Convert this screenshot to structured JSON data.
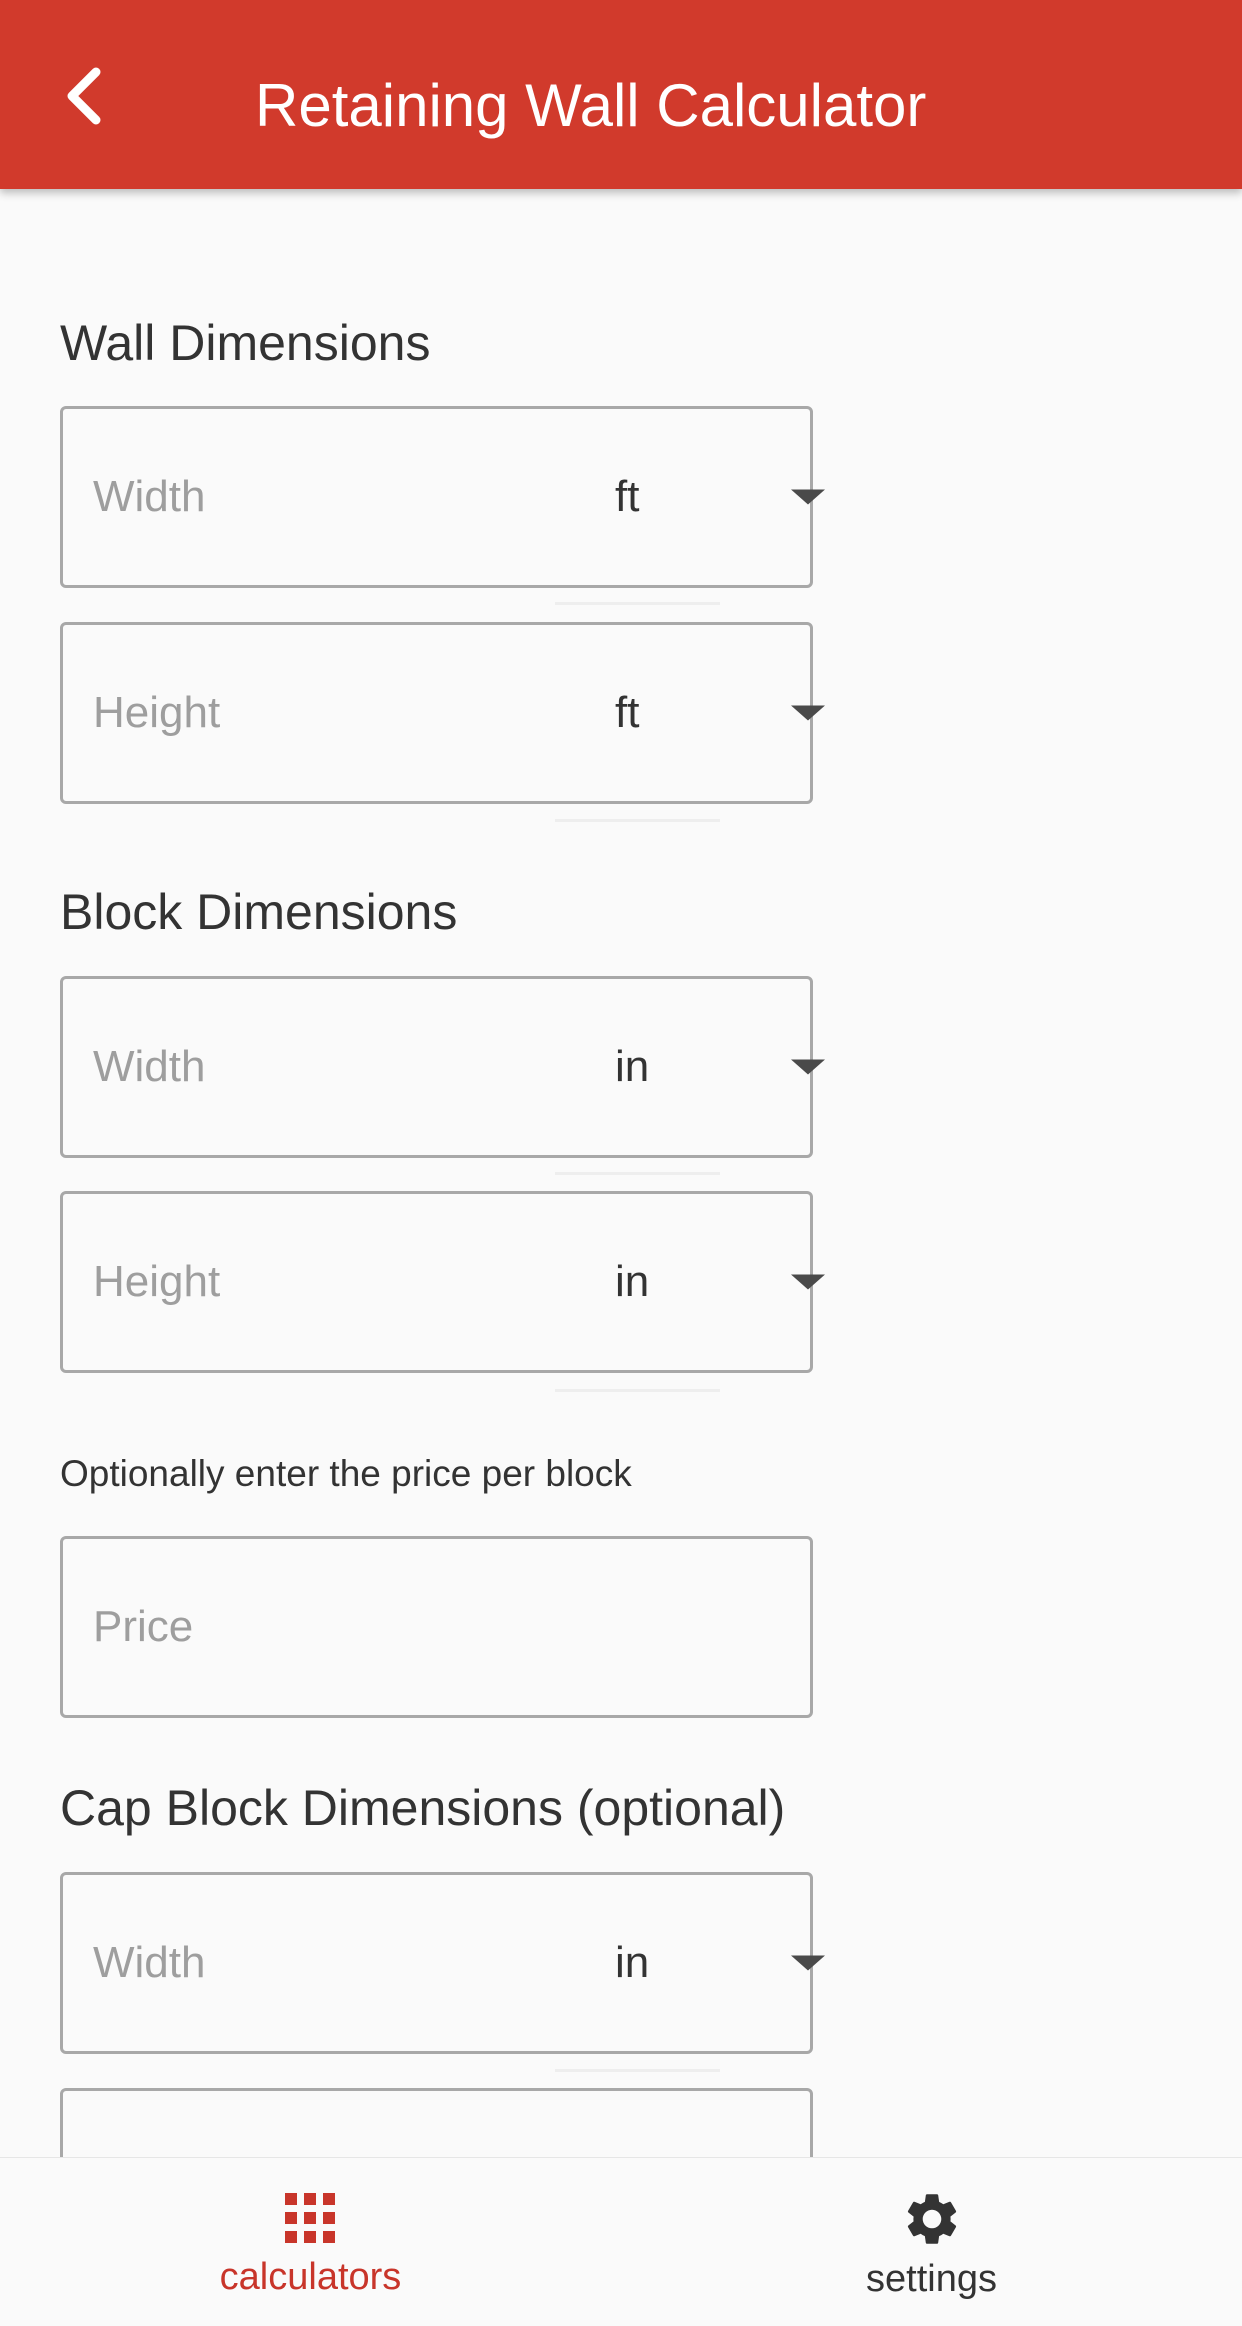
{
  "app_bar": {
    "title": "Retaining Wall Calculator",
    "back_icon": "chevron-left-icon",
    "color": "#d13a2c"
  },
  "wall_dimensions": {
    "title": "Wall Dimensions",
    "width": {
      "placeholder": "Width",
      "value": "",
      "unit": "ft"
    },
    "height": {
      "placeholder": "Height",
      "value": "",
      "unit": "ft"
    }
  },
  "block_dimensions": {
    "title": "Block Dimensions",
    "width": {
      "placeholder": "Width",
      "value": "",
      "unit": "in"
    },
    "height": {
      "placeholder": "Height",
      "value": "",
      "unit": "in"
    }
  },
  "price": {
    "hint": "Optionally enter the price per block",
    "placeholder": "Price",
    "value": ""
  },
  "cap_block_dimensions": {
    "title": "Cap Block Dimensions (optional)",
    "width": {
      "placeholder": "Width",
      "value": "",
      "unit": "in"
    }
  },
  "bottom_nav": {
    "items": [
      {
        "label": "calculators",
        "icon": "grid-icon",
        "active": true
      },
      {
        "label": "settings",
        "icon": "gear-icon",
        "active": false
      }
    ],
    "active_color": "#c8352a",
    "inactive_color": "#333333"
  }
}
